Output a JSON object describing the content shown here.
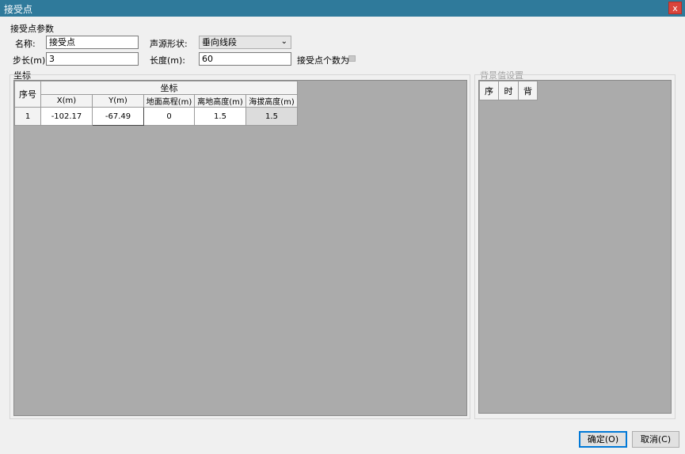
{
  "window": {
    "title": "接受点",
    "close_label": "x"
  },
  "params": {
    "section_label": "接受点参数",
    "name_label": "名称:",
    "name_value": "接受点",
    "shape_label": "声源形状:",
    "shape_value": "垂向线段",
    "step_label": "步长(m):",
    "step_value": "3",
    "length_label": "长度(m):",
    "length_value": "60",
    "count_label": "接受点个数为"
  },
  "coords": {
    "section_label": "坐标",
    "header_seq": "序号",
    "header_group": "坐标",
    "columns": [
      "X(m)",
      "Y(m)",
      "地面高程(m)",
      "离地高度(m)",
      "海拔高度(m)"
    ],
    "rows": [
      {
        "seq": "1",
        "x": "-102.17",
        "y": "-67.49",
        "ground": "0",
        "height": "1.5",
        "altitude": "1.5"
      }
    ]
  },
  "background": {
    "section_label": "背景值设置",
    "columns": [
      "序",
      "时",
      "背"
    ]
  },
  "buttons": {
    "ok": "确定(O)",
    "cancel": "取消(C)"
  }
}
